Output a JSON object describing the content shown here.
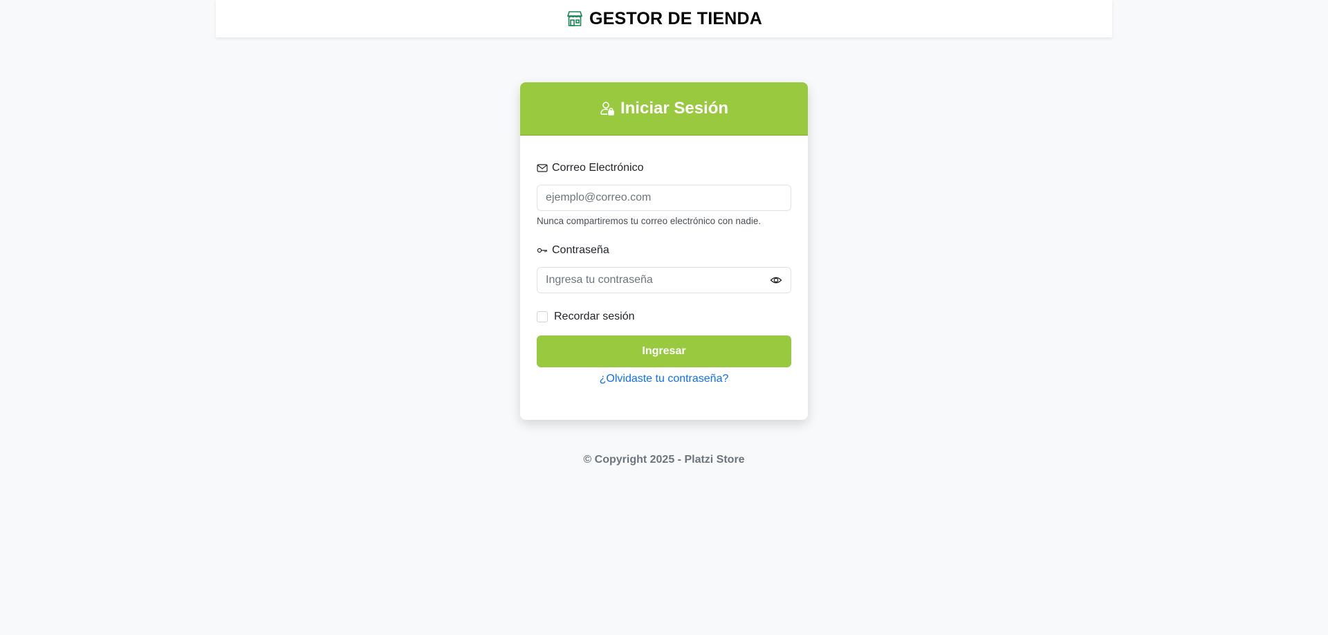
{
  "header": {
    "brand_title": "GESTOR DE TIENDA",
    "brand_icon": "shop-icon"
  },
  "login": {
    "title": "Iniciar Sesión",
    "title_icon": "person-lock-icon",
    "email": {
      "label": "Correo Electrónico",
      "icon": "envelope-icon",
      "placeholder": "ejemplo@correo.com",
      "value": "",
      "help": "Nunca compartiremos tu correo electrónico con nadie."
    },
    "password": {
      "label": "Contraseña",
      "icon": "key-icon",
      "placeholder": "Ingresa tu contraseña",
      "value": "",
      "toggle_icon": "eye-icon"
    },
    "remember": {
      "label": "Recordar sesión",
      "checked": false
    },
    "submit_label": "Ingresar",
    "forgot_label": "¿Olvidaste tu contraseña?"
  },
  "footer": {
    "text": "© Copyright 2025 - Platzi Store"
  },
  "colors": {
    "accent": "#98c93f",
    "link": "#0d6efd",
    "background": "#f8f9fa"
  }
}
